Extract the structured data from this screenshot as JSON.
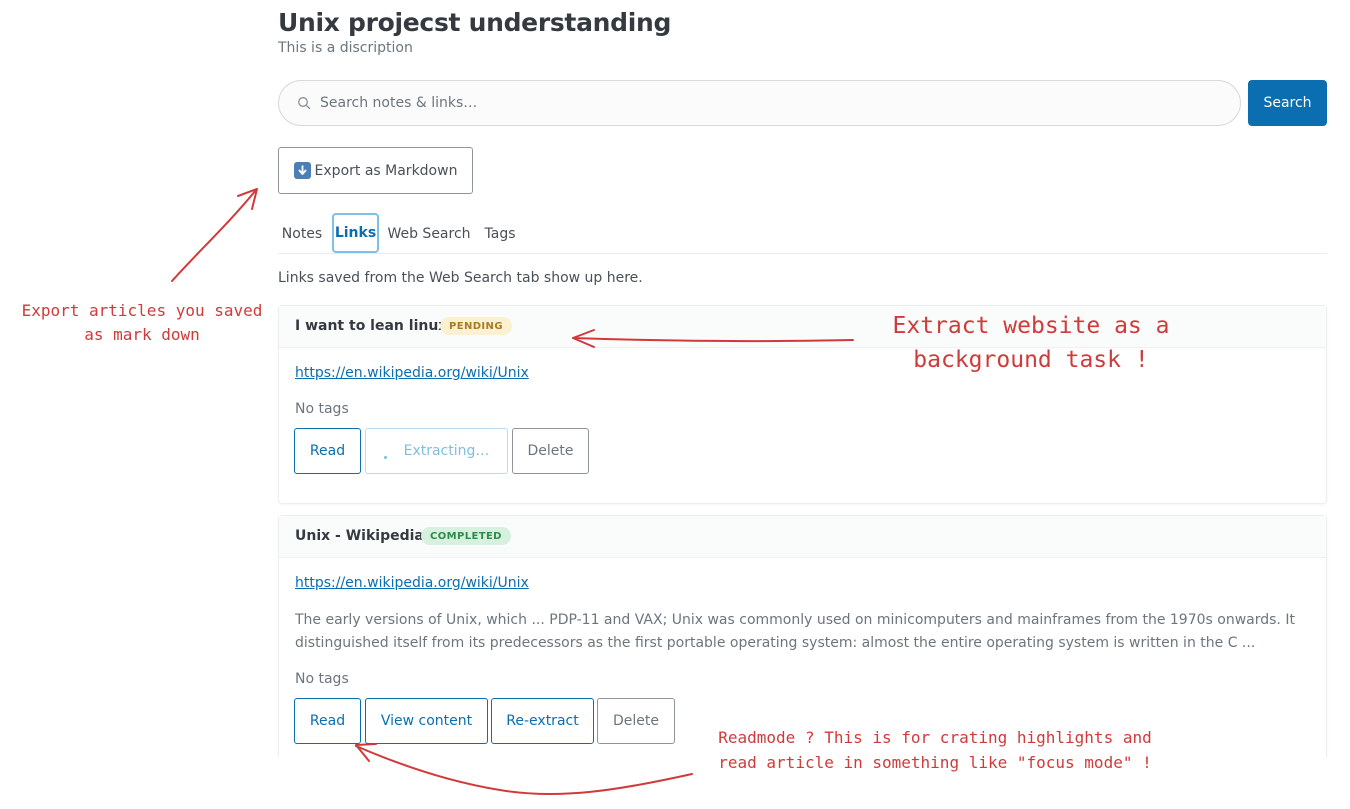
{
  "header": {
    "title": "Unix projecst understanding",
    "subtitle": "This is a discription"
  },
  "search": {
    "placeholder": "Search notes & links…",
    "button_label": "Search"
  },
  "export": {
    "label": "Export as Markdown",
    "icon": "down-arrow-icon"
  },
  "tabs": [
    {
      "label": "Notes",
      "active": false
    },
    {
      "label": "Links",
      "active": true
    },
    {
      "label": "Web Search",
      "active": false
    },
    {
      "label": "Tags",
      "active": false
    }
  ],
  "links_hint": "Links saved from the Web Search tab show up here.",
  "links": [
    {
      "title": "I want to lean linux",
      "status": "PENDING",
      "url": "https://en.wikipedia.org/wiki/Unix",
      "tags": "No tags",
      "buttons": [
        "Read",
        "Extracting…",
        "Delete"
      ]
    },
    {
      "title": "Unix - Wikipedia",
      "status": "COMPLETED",
      "url": "https://en.wikipedia.org/wiki/Unix",
      "excerpt_line1": "The early versions of Unix, which ... PDP-11 and VAX; Unix was commonly used on minicomputers and mainframes from the 1970s onwards. It",
      "excerpt_line2": "distinguished itself from its predecessors as the first portable operating system: almost the entire operating system is written in the C ...",
      "tags": "No tags",
      "buttons": [
        "Read",
        "View content",
        "Re-extract",
        "Delete"
      ]
    }
  ],
  "annotations": {
    "export_note_line1": "Export articles you saved",
    "export_note_line2": "as mark down",
    "extract_note_line1": "Extract website as a",
    "extract_note_line2": "background task !",
    "read_note_line1": "Readmode ? This is for crating highlights and",
    "read_note_line2": "read article in something like \"focus mode\" !"
  },
  "colors": {
    "accent": "#0a6eb0",
    "pending_badge": "#fbf0d2",
    "completed_badge": "#d6f2de",
    "annotation": "#d13a3a"
  }
}
